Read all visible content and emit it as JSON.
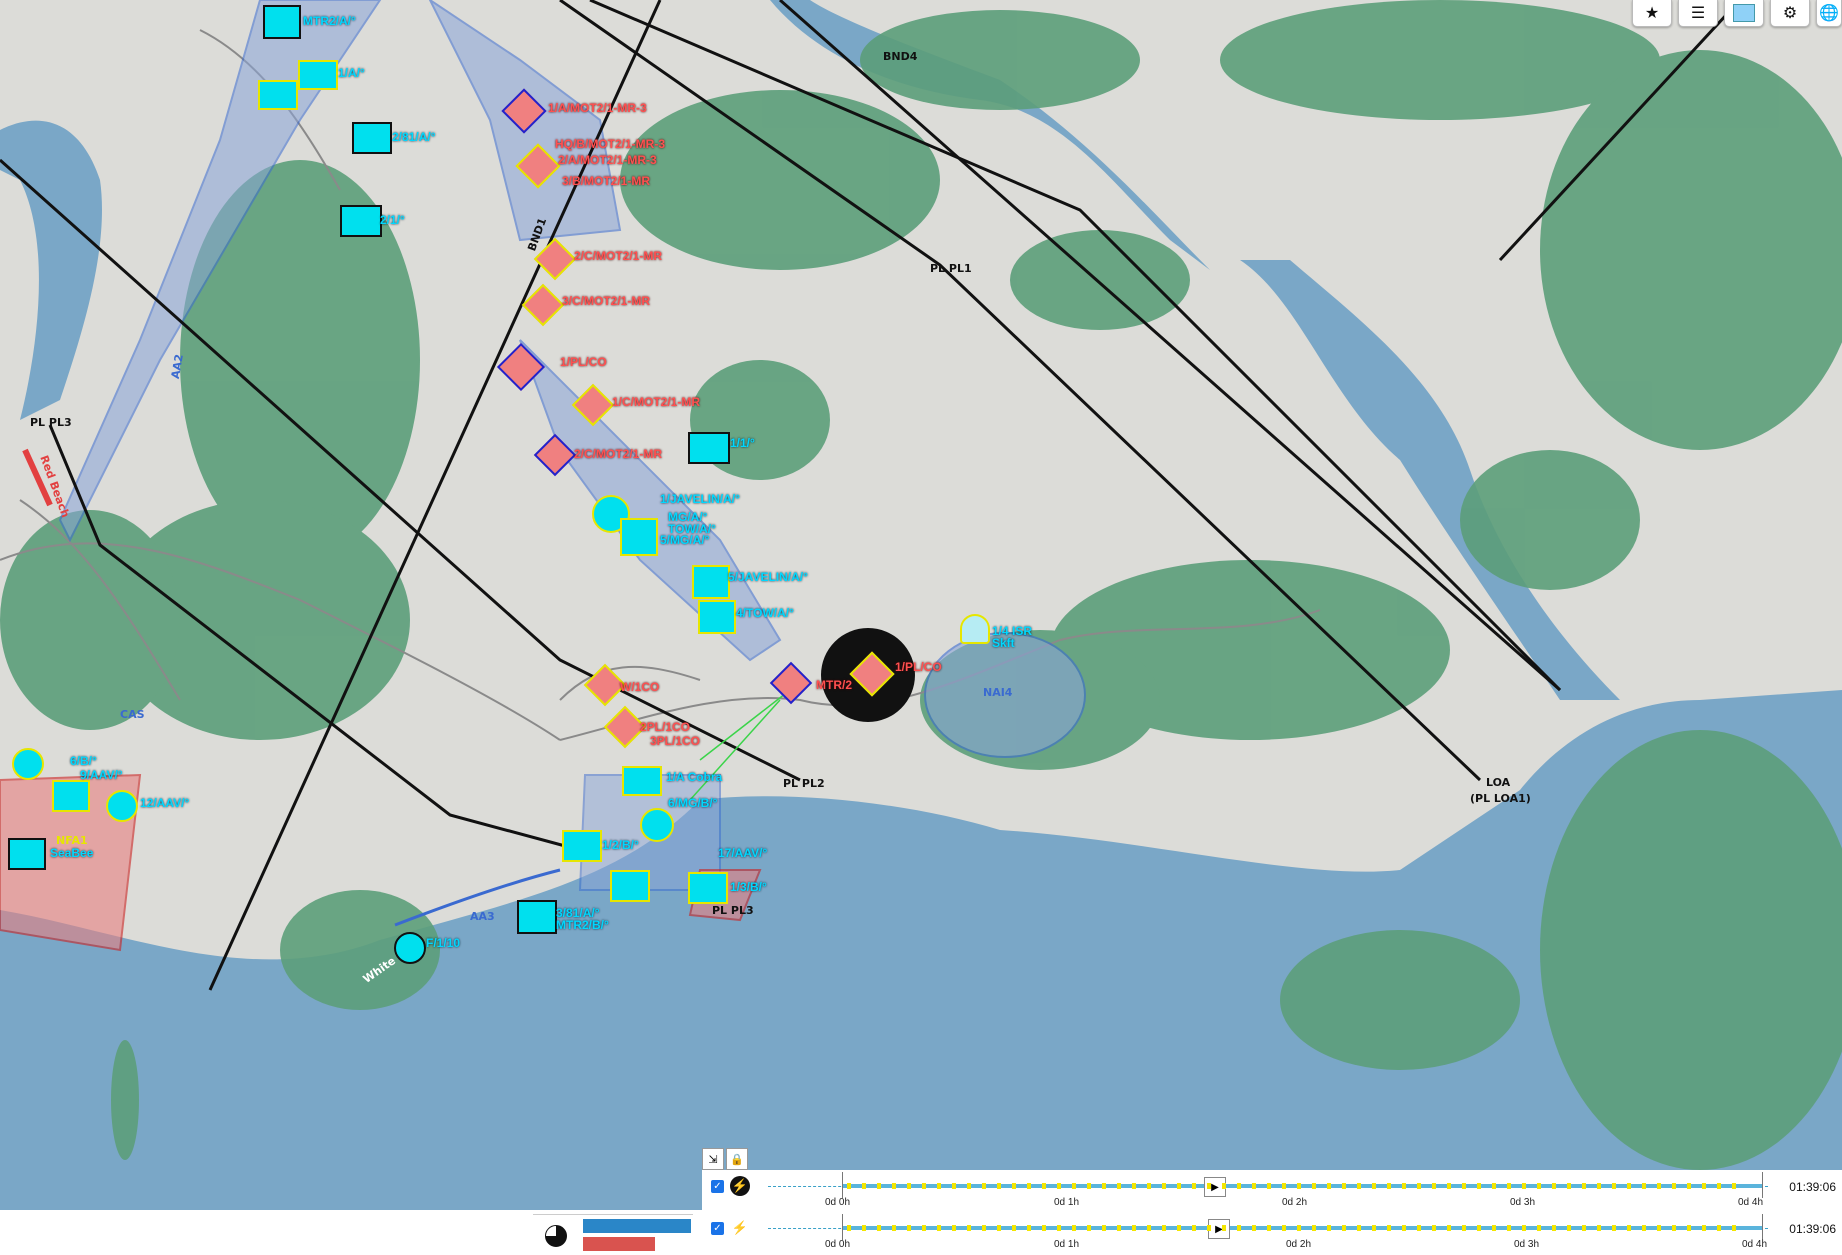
{
  "toolbar": {
    "buttons": [
      {
        "name": "favorites",
        "icon": "star-icon",
        "glyph": "★"
      },
      {
        "name": "layers-list",
        "icon": "list-icon",
        "glyph": "☰"
      },
      {
        "name": "map-style",
        "icon": "map-swatch-icon",
        "glyph": ""
      },
      {
        "name": "filters",
        "icon": "sliders-icon",
        "glyph": "⚙"
      },
      {
        "name": "globe",
        "icon": "globe-icon",
        "glyph": "🌐"
      }
    ]
  },
  "map": {
    "phase_lines": {
      "bnd4": "BND4",
      "pl1": "PL PL1",
      "pl2": "PL PL2",
      "pl3_west": "PL PL3",
      "pl3_south": "PL PL3",
      "bnd1": "BND1",
      "loa": "LOA",
      "loa_sub": "(PL LOA1)",
      "aa2": "AA2",
      "aa3": "AA3",
      "cas": "CAS",
      "nai4": "NAI4",
      "red_beach": "Red Beach",
      "white_beach": "White B"
    },
    "units": {
      "mtr2a": "MTR2/A/°",
      "u1a": "1/A/°",
      "u81a": "2/81/A/°",
      "u21": "2/1/°",
      "u11": "1/1/°",
      "m1": "HQ/B/MOT2/1-MR-3",
      "m2": "1/A/MOT2/1-MR-3",
      "m3": "2/A/MOT2/1-MR-3",
      "m4": "3/B/MOT2/1-MR",
      "m5": "2/C/MOT2/1-MR",
      "m6": "3/C/MOT2/1-MR",
      "m7": "1/PL/CO",
      "m8": "1/C/MOT2/1-MR",
      "m9": "2/C/MOT2/1-MR",
      "jav": "1/JAVELIN/A/°",
      "mgA": "MG/A/°",
      "tow": "TOW/A/°",
      "mg5": "5/MG/A/°",
      "jav5": "5/JAVELIN/A/°",
      "tow4": "4/TOW/A/°",
      "isr": "1/4 ISR",
      "skft": "Skft",
      "mtr2": "MTR/2",
      "bmr": "1/PL/CO",
      "wco": "W/1CO",
      "pl2co": "2PL/1CO",
      "pl3co": "3PL/1CO",
      "cobra": "1/A Cobra",
      "mg6": "6/MG/B/°",
      "aav12": "12/AAV/°",
      "aav9": "9/AAV/°",
      "gb": "6/B/°",
      "seabee": "SeaBee",
      "nfa1": "NFA1",
      "b12": "1/2/B/°",
      "b7": "17/AAV/°",
      "b13": "1/3/B/°",
      "a381": "3/81/A/°",
      "mtr2b": "MTR2/B/°",
      "f110": "F/1/10"
    }
  },
  "controls": {
    "collapse": "⇲",
    "lock": "🔒"
  },
  "timelines": [
    {
      "labels": [
        "0d 0h",
        "0d 1h",
        "0d 2h",
        "0d 3h",
        "0d 4h"
      ],
      "time": "01:39:06",
      "icon_color": "#111",
      "icon": "lightning-icon"
    },
    {
      "labels": [
        "0d 0h",
        "0d 1h",
        "0d 2h",
        "0d 3h",
        "0d 4h"
      ],
      "time": "01:39:06",
      "icon_color": "#1a73e8",
      "icon": "lightning-icon"
    }
  ],
  "stats": {
    "blue": "#2a86c8",
    "red": "#d9534f",
    "blue_strength": 1.0,
    "red_strength": 0.67
  }
}
